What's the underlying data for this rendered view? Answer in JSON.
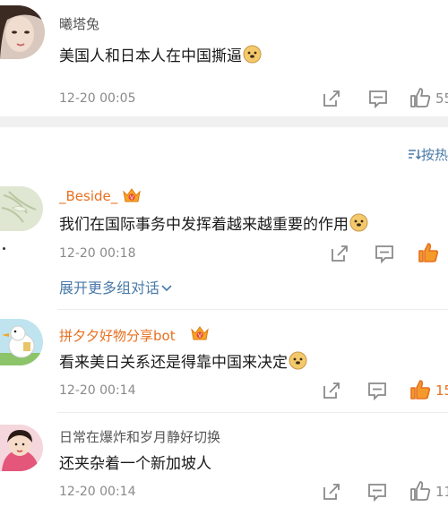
{
  "sort_label": "按热",
  "comments": [
    {
      "username": "曦塔兔",
      "content": "美国人和日本人在中国撕逼",
      "time": "12-20 00:05",
      "like_count": "55",
      "liked": false
    },
    {
      "username": "_Beside_",
      "content": "我们在国际事务中发挥着越来越重要的作用",
      "time": "12-20 00:18",
      "like_count": "",
      "liked": true,
      "expand_text": "展开更多组对话"
    },
    {
      "username": "拼夕夕好物分享bot",
      "content": "看来美日关系还是得靠中国来决定",
      "time": "12-20 00:14",
      "like_count": "15",
      "liked": true
    },
    {
      "username": "日常在爆炸和岁月静好切换",
      "content": "还夹杂着一个新加坡人",
      "time": "12-20 00:14",
      "like_count": "11",
      "liked": false
    }
  ],
  "colors": {
    "accent": "#e8701f",
    "link": "#4a7aa8",
    "time": "#8a8a8a",
    "separator": "#f0f0f0"
  }
}
